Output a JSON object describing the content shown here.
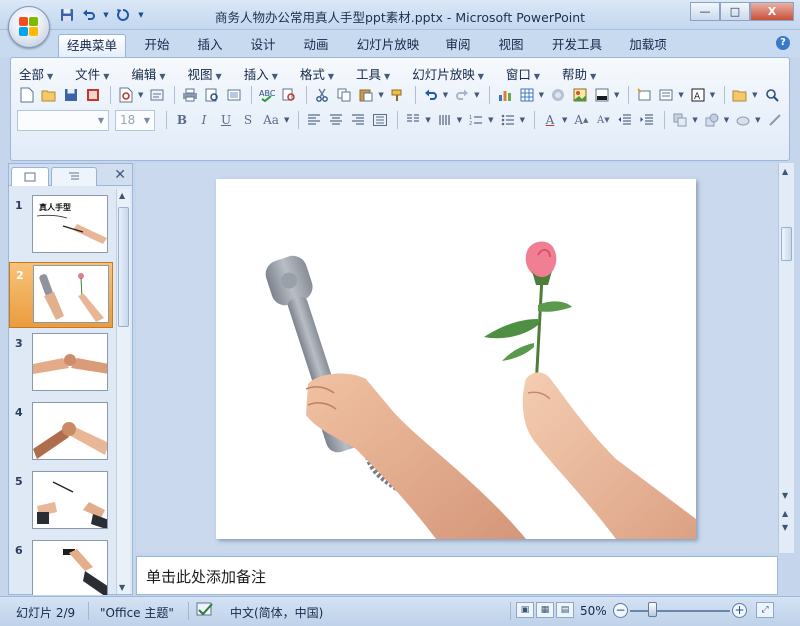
{
  "window": {
    "title": "商务人物办公常用真人手型ppt素材.pptx - Microsoft PowerPoint",
    "controls": {
      "minimize": "—",
      "maximize": "□",
      "close": "X"
    }
  },
  "quick_access": [
    "save-icon",
    "undo-icon",
    "redo-icon",
    "customize-icon"
  ],
  "tabs": [
    {
      "label": "经典菜单",
      "active": true
    },
    {
      "label": "开始"
    },
    {
      "label": "插入"
    },
    {
      "label": "设计"
    },
    {
      "label": "动画"
    },
    {
      "label": "幻灯片放映"
    },
    {
      "label": "审阅"
    },
    {
      "label": "视图"
    },
    {
      "label": "开发工具"
    },
    {
      "label": "加载项"
    }
  ],
  "classic_menu": [
    "全部",
    "文件",
    "编辑",
    "视图",
    "插入",
    "格式",
    "工具",
    "幻灯片放映",
    "窗口",
    "帮助"
  ],
  "format_bar": {
    "font_name": "",
    "font_size": "18",
    "buttons": [
      "B",
      "I",
      "U",
      "S",
      "Aa"
    ]
  },
  "slide_panel": {
    "tabs": [
      "slides-tab",
      "outline-tab"
    ],
    "close": "✕",
    "thumbnails": [
      {
        "number": "1",
        "caption": "真人手型",
        "selected": false
      },
      {
        "number": "2",
        "selected": true
      },
      {
        "number": "3",
        "selected": false
      },
      {
        "number": "4",
        "selected": false
      },
      {
        "number": "5",
        "selected": false
      },
      {
        "number": "6",
        "selected": false
      }
    ]
  },
  "notes": {
    "placeholder": "单击此处添加备注"
  },
  "status_bar": {
    "slide_info": "幻灯片 2/9",
    "theme": "\"Office 主题\"",
    "language": "中文(简体，中国)",
    "zoom": "50%",
    "zoom_minus": "−",
    "zoom_plus": "+"
  }
}
